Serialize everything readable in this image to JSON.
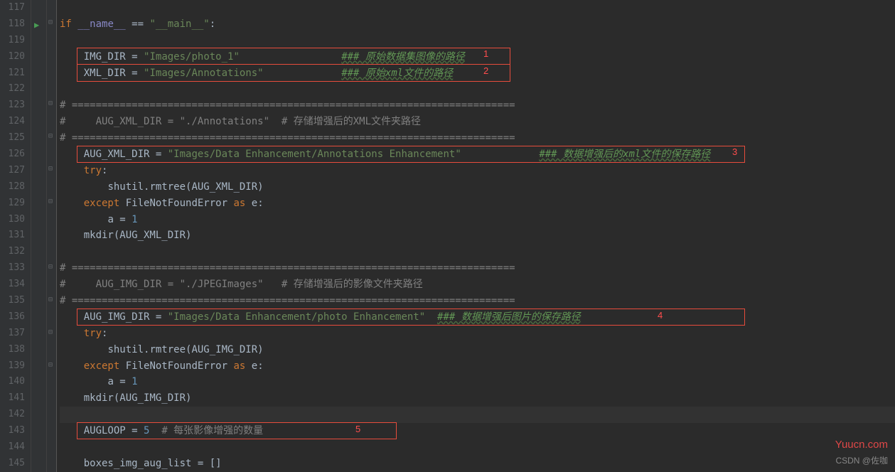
{
  "lines": {
    "start": 117,
    "end": 145
  },
  "code": {
    "l118": {
      "kw1": "if ",
      "b1": "__name__",
      "op": " == ",
      "s1": "\"__main__\"",
      "op2": ":"
    },
    "l120": {
      "id1": "IMG_DIR",
      "op": " = ",
      "s1": "\"Images/photo_1\"",
      "pad": "                 ",
      "c1": "### 原始数据集图像的路径"
    },
    "l121": {
      "id1": "XML_DIR",
      "op": " = ",
      "s1": "\"Images/Annotations\"",
      "pad": "             ",
      "c1": "### 原始xml文件的路径"
    },
    "l123": {
      "c1": "# =========================================================================="
    },
    "l124": {
      "c1": "#     AUG_XML_DIR = \"./Annotations\"  # 存储增强后的XML文件夹路径"
    },
    "l125": {
      "c1": "# =========================================================================="
    },
    "l126": {
      "id1": "AUG_XML_DIR",
      "op": " = ",
      "s1": "\"Images/Data Enhancement/Annotations Enhancement\"",
      "pad": "             ",
      "c1": "### 数据增强后的xml文件的保存路径"
    },
    "l127": {
      "kw1": "try",
      "op": ":"
    },
    "l128": {
      "id1": "shutil.rmtree(AUG_XML_DIR)"
    },
    "l129": {
      "kw1": "except ",
      "id1": "FileNotFoundError",
      "kw2": " as ",
      "id2": "e",
      "op": ":"
    },
    "l130": {
      "id1": "a",
      "op": " = ",
      "n1": "1"
    },
    "l131": {
      "id1": "mkdir(AUG_XML_DIR)"
    },
    "l133": {
      "c1": "# =========================================================================="
    },
    "l134": {
      "c1": "#     AUG_IMG_DIR = \"./JPEGImages\"   # 存储增强后的影像文件夹路径"
    },
    "l135": {
      "c1": "# =========================================================================="
    },
    "l136": {
      "id1": "AUG_IMG_DIR",
      "op": " = ",
      "s1": "\"Images/Data Enhancement/photo Enhancement\"",
      "pad": "  ",
      "c1": "### 数据增强后图片的保存路径"
    },
    "l137": {
      "kw1": "try",
      "op": ":"
    },
    "l138": {
      "id1": "shutil.rmtree(AUG_IMG_DIR)"
    },
    "l139": {
      "kw1": "except ",
      "id1": "FileNotFoundError",
      "kw2": " as ",
      "id2": "e",
      "op": ":"
    },
    "l140": {
      "id1": "a",
      "op": " = ",
      "n1": "1"
    },
    "l141": {
      "id1": "mkdir(AUG_IMG_DIR)"
    },
    "l143": {
      "id1": "AUGLOOP",
      "op": " = ",
      "n1": "5",
      "pad": "  ",
      "c1": "# 每张影像增强的数量"
    },
    "l145": {
      "id1": "boxes_img_aug_list",
      "op": " = []"
    }
  },
  "annotations": {
    "box1_label": "1",
    "box2_label": "2",
    "box3_label": "3",
    "box4_label": "4",
    "box5_label": "5"
  },
  "watermark": "Yuucn.com",
  "csdn": "CSDN @佐咖"
}
